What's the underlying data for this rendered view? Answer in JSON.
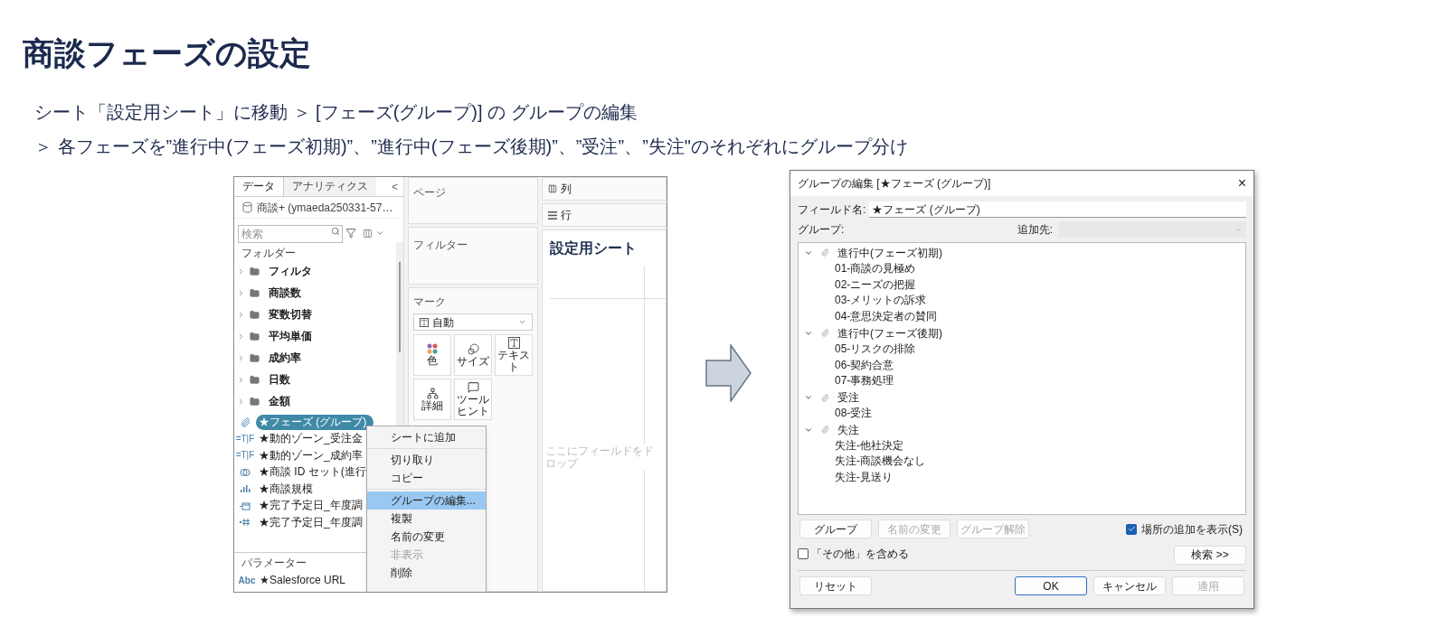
{
  "title": "商談フェーズの設定",
  "instructions": [
    "シート「設定用シート」に移動 ＞ [フェーズ(グループ)] の グループの編集",
    "＞ 各フェーズを”進行中(フェーズ初期)”、”進行中(フェーズ後期)”、”受注”、”失注\"のそれぞれにグループ分け"
  ],
  "tableau": {
    "data_pane": {
      "tabs": [
        {
          "label": "データ",
          "selected": true
        },
        {
          "label": "アナリティクス",
          "selected": false
        }
      ],
      "collapse_button": "<",
      "data_source": "商談+ (ymaeda250331-57…",
      "search": {
        "placeholder": "検索"
      },
      "folders_label": "フォルダー",
      "folders": [
        {
          "name": "フィルタ",
          "expanded": false
        },
        {
          "name": "商談数",
          "expanded": false
        },
        {
          "name": "変数切替",
          "expanded": false
        },
        {
          "name": "平均単価",
          "expanded": false
        },
        {
          "name": "成約率",
          "expanded": false
        },
        {
          "name": "日数",
          "expanded": false
        },
        {
          "name": "金額",
          "expanded": false
        }
      ],
      "fields": [
        {
          "kind": "group",
          "name": "★フェーズ (グループ)",
          "selected": true
        },
        {
          "kind": "boolean",
          "type_label": "=T|F",
          "name": "★動的ゾーン_受注金",
          "selected": false
        },
        {
          "kind": "boolean",
          "type_label": "=T|F",
          "name": "★動的ゾーン_成約率",
          "selected": false
        },
        {
          "kind": "set",
          "name": "★商談 ID セット(進行",
          "selected": false
        },
        {
          "kind": "bin",
          "name": "★商談規模",
          "selected": false
        },
        {
          "kind": "date",
          "name": "★完了予定日_年度調",
          "selected": false
        },
        {
          "kind": "number",
          "name": "★完了予定日_年度調",
          "selected": false
        }
      ],
      "parameters_label": "パラメーター",
      "parameters": [
        {
          "type_label": "Abc",
          "name": "★Salesforce URL"
        }
      ]
    },
    "pages_label": "ページ",
    "filters_label": "フィルター",
    "marks": {
      "label": "マーク",
      "mark_type": "自動",
      "buttons": [
        {
          "kind": "color",
          "label": "色"
        },
        {
          "kind": "size",
          "label": "サイズ"
        },
        {
          "kind": "text",
          "label": "テキスト"
        },
        {
          "kind": "detail",
          "label": "詳細"
        },
        {
          "kind": "tooltip",
          "label": "ツールヒント"
        }
      ]
    },
    "columns_label": "列",
    "rows_label": "行",
    "sheet_title": "設定用シート",
    "drop_hint": "ここにフィールドをドロップ",
    "context_menu": [
      [
        {
          "label": "シートに追加",
          "selected": false,
          "disabled": false
        }
      ],
      [
        {
          "label": "切り取り",
          "selected": false,
          "disabled": false
        },
        {
          "label": "コピー",
          "selected": false,
          "disabled": false
        }
      ],
      [
        {
          "label": "グループの編集...",
          "selected": true,
          "disabled": false
        },
        {
          "label": "複製",
          "selected": false,
          "disabled": false
        },
        {
          "label": "名前の変更",
          "selected": false,
          "disabled": false
        },
        {
          "label": "非表示",
          "selected": false,
          "disabled": true
        },
        {
          "label": "削除",
          "selected": false,
          "disabled": false
        }
      ]
    ]
  },
  "dialog": {
    "title": "グループの編集 [★フェーズ (グループ)]",
    "close": "×",
    "field_name": {
      "label": "フィールド名:",
      "value": "★フェーズ (グループ)"
    },
    "groups_label": "グループ:",
    "add_to": {
      "label": "追加先:"
    },
    "tree": [
      {
        "name": "進行中(フェーズ初期)",
        "expanded": true,
        "children": [
          {
            "name": "01-商談の見極め"
          },
          {
            "name": "02-ニーズの把握"
          },
          {
            "name": "03-メリットの訴求"
          },
          {
            "name": "04-意思決定者の賛同"
          }
        ]
      },
      {
        "name": "進行中(フェーズ後期)",
        "expanded": true,
        "children": [
          {
            "name": "05-リスクの排除"
          },
          {
            "name": "06-契約合意"
          },
          {
            "name": "07-事務処理"
          }
        ]
      },
      {
        "name": "受注",
        "expanded": true,
        "children": [
          {
            "name": "08-受注"
          }
        ]
      },
      {
        "name": "失注",
        "expanded": true,
        "children": [
          {
            "name": "失注-他社決定"
          },
          {
            "name": "失注-商談機会なし"
          },
          {
            "name": "失注-見送り"
          }
        ]
      }
    ],
    "group_buttons": [
      {
        "label": "グループ",
        "disabled": false
      },
      {
        "label": "名前の変更",
        "disabled": true
      },
      {
        "label": "グループ解除",
        "disabled": true
      }
    ],
    "show_location": {
      "label": "場所の追加を表示(S)",
      "checked": true
    },
    "include_other": {
      "label": "「その他」を含める",
      "checked": false
    },
    "search_button": "検索 >>",
    "reset_button": "リセット",
    "footer_buttons": [
      {
        "label": "OK",
        "default": true,
        "disabled": false
      },
      {
        "label": "キャンセル",
        "default": false,
        "disabled": false
      },
      {
        "label": "適用",
        "default": false,
        "disabled": true
      }
    ]
  }
}
